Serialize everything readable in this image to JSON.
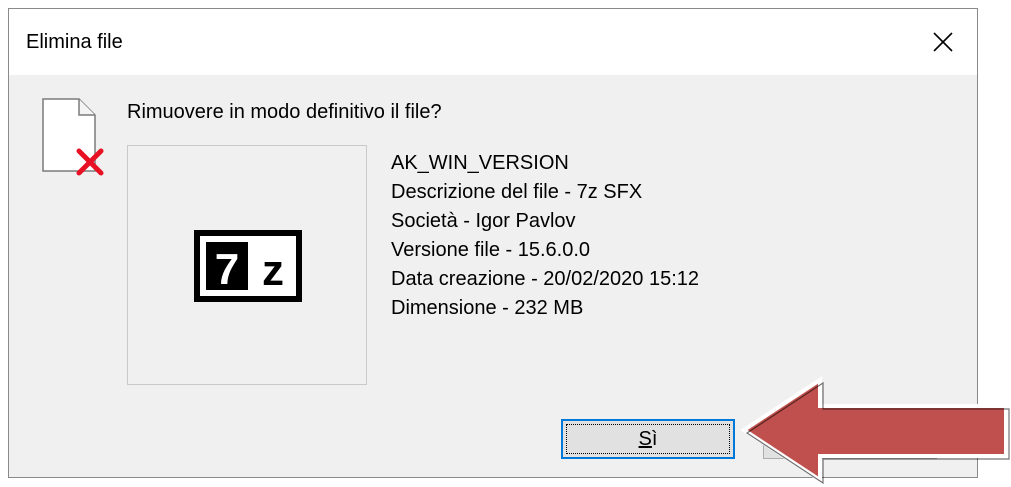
{
  "dialog": {
    "title": "Elimina file",
    "close_glyph": "✕",
    "question": "Rimuovere in modo definitivo il file?",
    "icon": "file-delete-icon",
    "thumbnail_icon": "7z-icon",
    "thumbnail_text": "7z"
  },
  "file_info": {
    "name": "AK_WIN_VERSION",
    "description": "Descrizione del file - 7z SFX",
    "company": "Società - Igor Pavlov",
    "version": "Versione file - 15.6.0.0",
    "created": "Data creazione - 20/02/2020 15:12",
    "size": "Dimensione - 232 MB"
  },
  "buttons": {
    "yes_mnemonic": "S",
    "yes_rest": "ì"
  },
  "annotation": {
    "arrow_color": "#c0504d",
    "arrow_direction": "left"
  },
  "colors": {
    "focus_border": "#0078d7",
    "delete_x": "#e81123"
  }
}
